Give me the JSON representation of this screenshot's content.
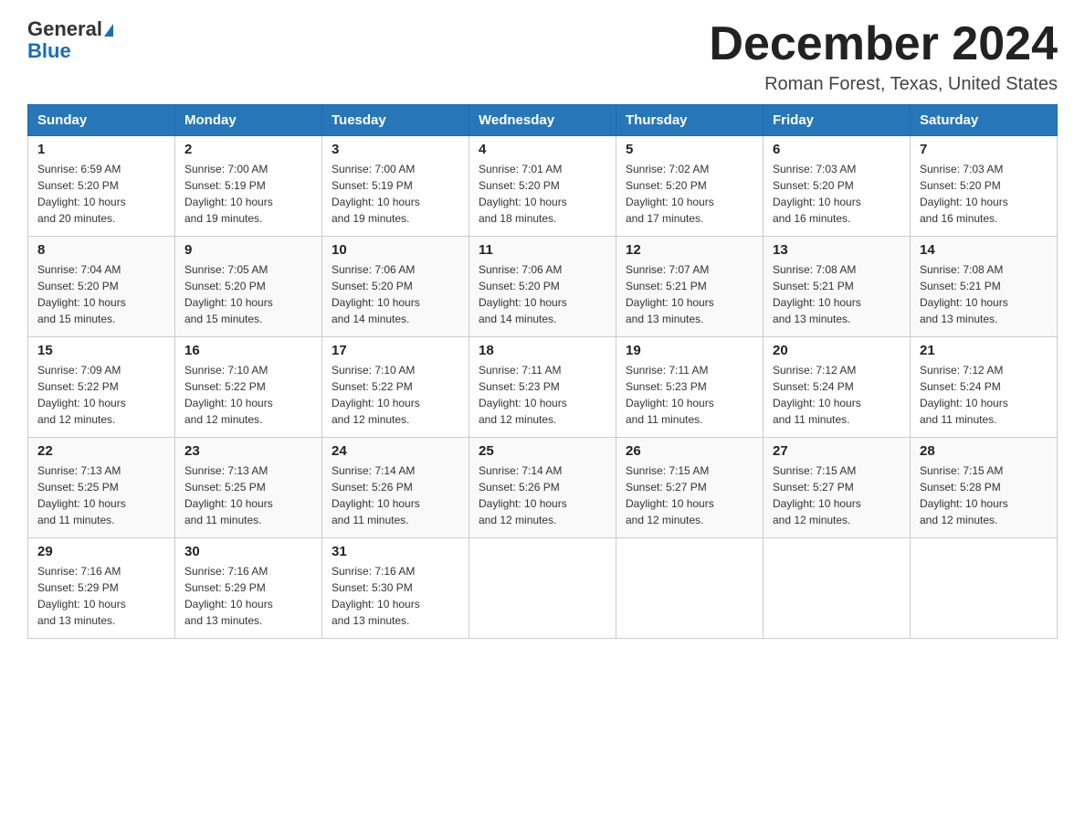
{
  "header": {
    "logo_general": "General",
    "logo_blue": "Blue",
    "month_title": "December 2024",
    "location": "Roman Forest, Texas, United States"
  },
  "weekdays": [
    "Sunday",
    "Monday",
    "Tuesday",
    "Wednesday",
    "Thursday",
    "Friday",
    "Saturday"
  ],
  "weeks": [
    [
      {
        "day": "1",
        "sunrise": "6:59 AM",
        "sunset": "5:20 PM",
        "daylight": "10 hours and 20 minutes."
      },
      {
        "day": "2",
        "sunrise": "7:00 AM",
        "sunset": "5:19 PM",
        "daylight": "10 hours and 19 minutes."
      },
      {
        "day": "3",
        "sunrise": "7:00 AM",
        "sunset": "5:19 PM",
        "daylight": "10 hours and 19 minutes."
      },
      {
        "day": "4",
        "sunrise": "7:01 AM",
        "sunset": "5:20 PM",
        "daylight": "10 hours and 18 minutes."
      },
      {
        "day": "5",
        "sunrise": "7:02 AM",
        "sunset": "5:20 PM",
        "daylight": "10 hours and 17 minutes."
      },
      {
        "day": "6",
        "sunrise": "7:03 AM",
        "sunset": "5:20 PM",
        "daylight": "10 hours and 16 minutes."
      },
      {
        "day": "7",
        "sunrise": "7:03 AM",
        "sunset": "5:20 PM",
        "daylight": "10 hours and 16 minutes."
      }
    ],
    [
      {
        "day": "8",
        "sunrise": "7:04 AM",
        "sunset": "5:20 PM",
        "daylight": "10 hours and 15 minutes."
      },
      {
        "day": "9",
        "sunrise": "7:05 AM",
        "sunset": "5:20 PM",
        "daylight": "10 hours and 15 minutes."
      },
      {
        "day": "10",
        "sunrise": "7:06 AM",
        "sunset": "5:20 PM",
        "daylight": "10 hours and 14 minutes."
      },
      {
        "day": "11",
        "sunrise": "7:06 AM",
        "sunset": "5:20 PM",
        "daylight": "10 hours and 14 minutes."
      },
      {
        "day": "12",
        "sunrise": "7:07 AM",
        "sunset": "5:21 PM",
        "daylight": "10 hours and 13 minutes."
      },
      {
        "day": "13",
        "sunrise": "7:08 AM",
        "sunset": "5:21 PM",
        "daylight": "10 hours and 13 minutes."
      },
      {
        "day": "14",
        "sunrise": "7:08 AM",
        "sunset": "5:21 PM",
        "daylight": "10 hours and 13 minutes."
      }
    ],
    [
      {
        "day": "15",
        "sunrise": "7:09 AM",
        "sunset": "5:22 PM",
        "daylight": "10 hours and 12 minutes."
      },
      {
        "day": "16",
        "sunrise": "7:10 AM",
        "sunset": "5:22 PM",
        "daylight": "10 hours and 12 minutes."
      },
      {
        "day": "17",
        "sunrise": "7:10 AM",
        "sunset": "5:22 PM",
        "daylight": "10 hours and 12 minutes."
      },
      {
        "day": "18",
        "sunrise": "7:11 AM",
        "sunset": "5:23 PM",
        "daylight": "10 hours and 12 minutes."
      },
      {
        "day": "19",
        "sunrise": "7:11 AM",
        "sunset": "5:23 PM",
        "daylight": "10 hours and 11 minutes."
      },
      {
        "day": "20",
        "sunrise": "7:12 AM",
        "sunset": "5:24 PM",
        "daylight": "10 hours and 11 minutes."
      },
      {
        "day": "21",
        "sunrise": "7:12 AM",
        "sunset": "5:24 PM",
        "daylight": "10 hours and 11 minutes."
      }
    ],
    [
      {
        "day": "22",
        "sunrise": "7:13 AM",
        "sunset": "5:25 PM",
        "daylight": "10 hours and 11 minutes."
      },
      {
        "day": "23",
        "sunrise": "7:13 AM",
        "sunset": "5:25 PM",
        "daylight": "10 hours and 11 minutes."
      },
      {
        "day": "24",
        "sunrise": "7:14 AM",
        "sunset": "5:26 PM",
        "daylight": "10 hours and 11 minutes."
      },
      {
        "day": "25",
        "sunrise": "7:14 AM",
        "sunset": "5:26 PM",
        "daylight": "10 hours and 12 minutes."
      },
      {
        "day": "26",
        "sunrise": "7:15 AM",
        "sunset": "5:27 PM",
        "daylight": "10 hours and 12 minutes."
      },
      {
        "day": "27",
        "sunrise": "7:15 AM",
        "sunset": "5:27 PM",
        "daylight": "10 hours and 12 minutes."
      },
      {
        "day": "28",
        "sunrise": "7:15 AM",
        "sunset": "5:28 PM",
        "daylight": "10 hours and 12 minutes."
      }
    ],
    [
      {
        "day": "29",
        "sunrise": "7:16 AM",
        "sunset": "5:29 PM",
        "daylight": "10 hours and 13 minutes."
      },
      {
        "day": "30",
        "sunrise": "7:16 AM",
        "sunset": "5:29 PM",
        "daylight": "10 hours and 13 minutes."
      },
      {
        "day": "31",
        "sunrise": "7:16 AM",
        "sunset": "5:30 PM",
        "daylight": "10 hours and 13 minutes."
      },
      null,
      null,
      null,
      null
    ]
  ],
  "labels": {
    "sunrise": "Sunrise:",
    "sunset": "Sunset:",
    "daylight": "Daylight:"
  }
}
